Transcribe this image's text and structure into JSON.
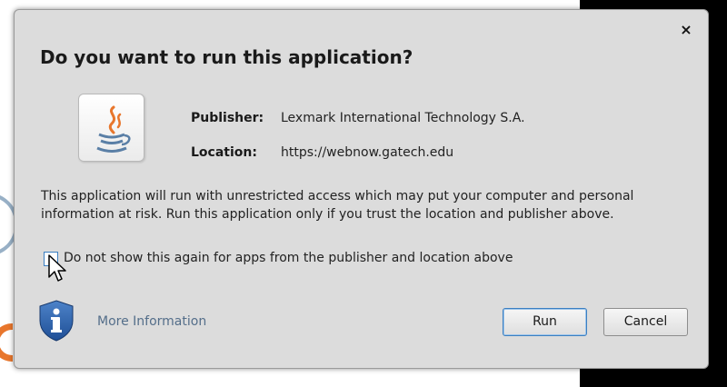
{
  "dialog": {
    "title": "Do you want to run this application?",
    "close_glyph": "×",
    "publisher_label": "Publisher:",
    "publisher_value": "Lexmark International Technology S.A.",
    "location_label": "Location:",
    "location_value": "https://webnow.gatech.edu",
    "warning_text": "This application will run with unrestricted access which may put your computer and personal information at risk. Run this application only if you trust the location and publisher above.",
    "checkbox_label": "Do not show this again for apps from the publisher and location above",
    "checkbox_checked": false,
    "more_info_label": "More Information",
    "run_label": "Run",
    "cancel_label": "Cancel"
  },
  "icons": {
    "app_icon": "java-icon",
    "info_icon": "shield-info-icon"
  },
  "colors": {
    "dialog_bg": "#dcdcdc",
    "link": "#546e8a",
    "focus_border": "#3c7fc1"
  }
}
